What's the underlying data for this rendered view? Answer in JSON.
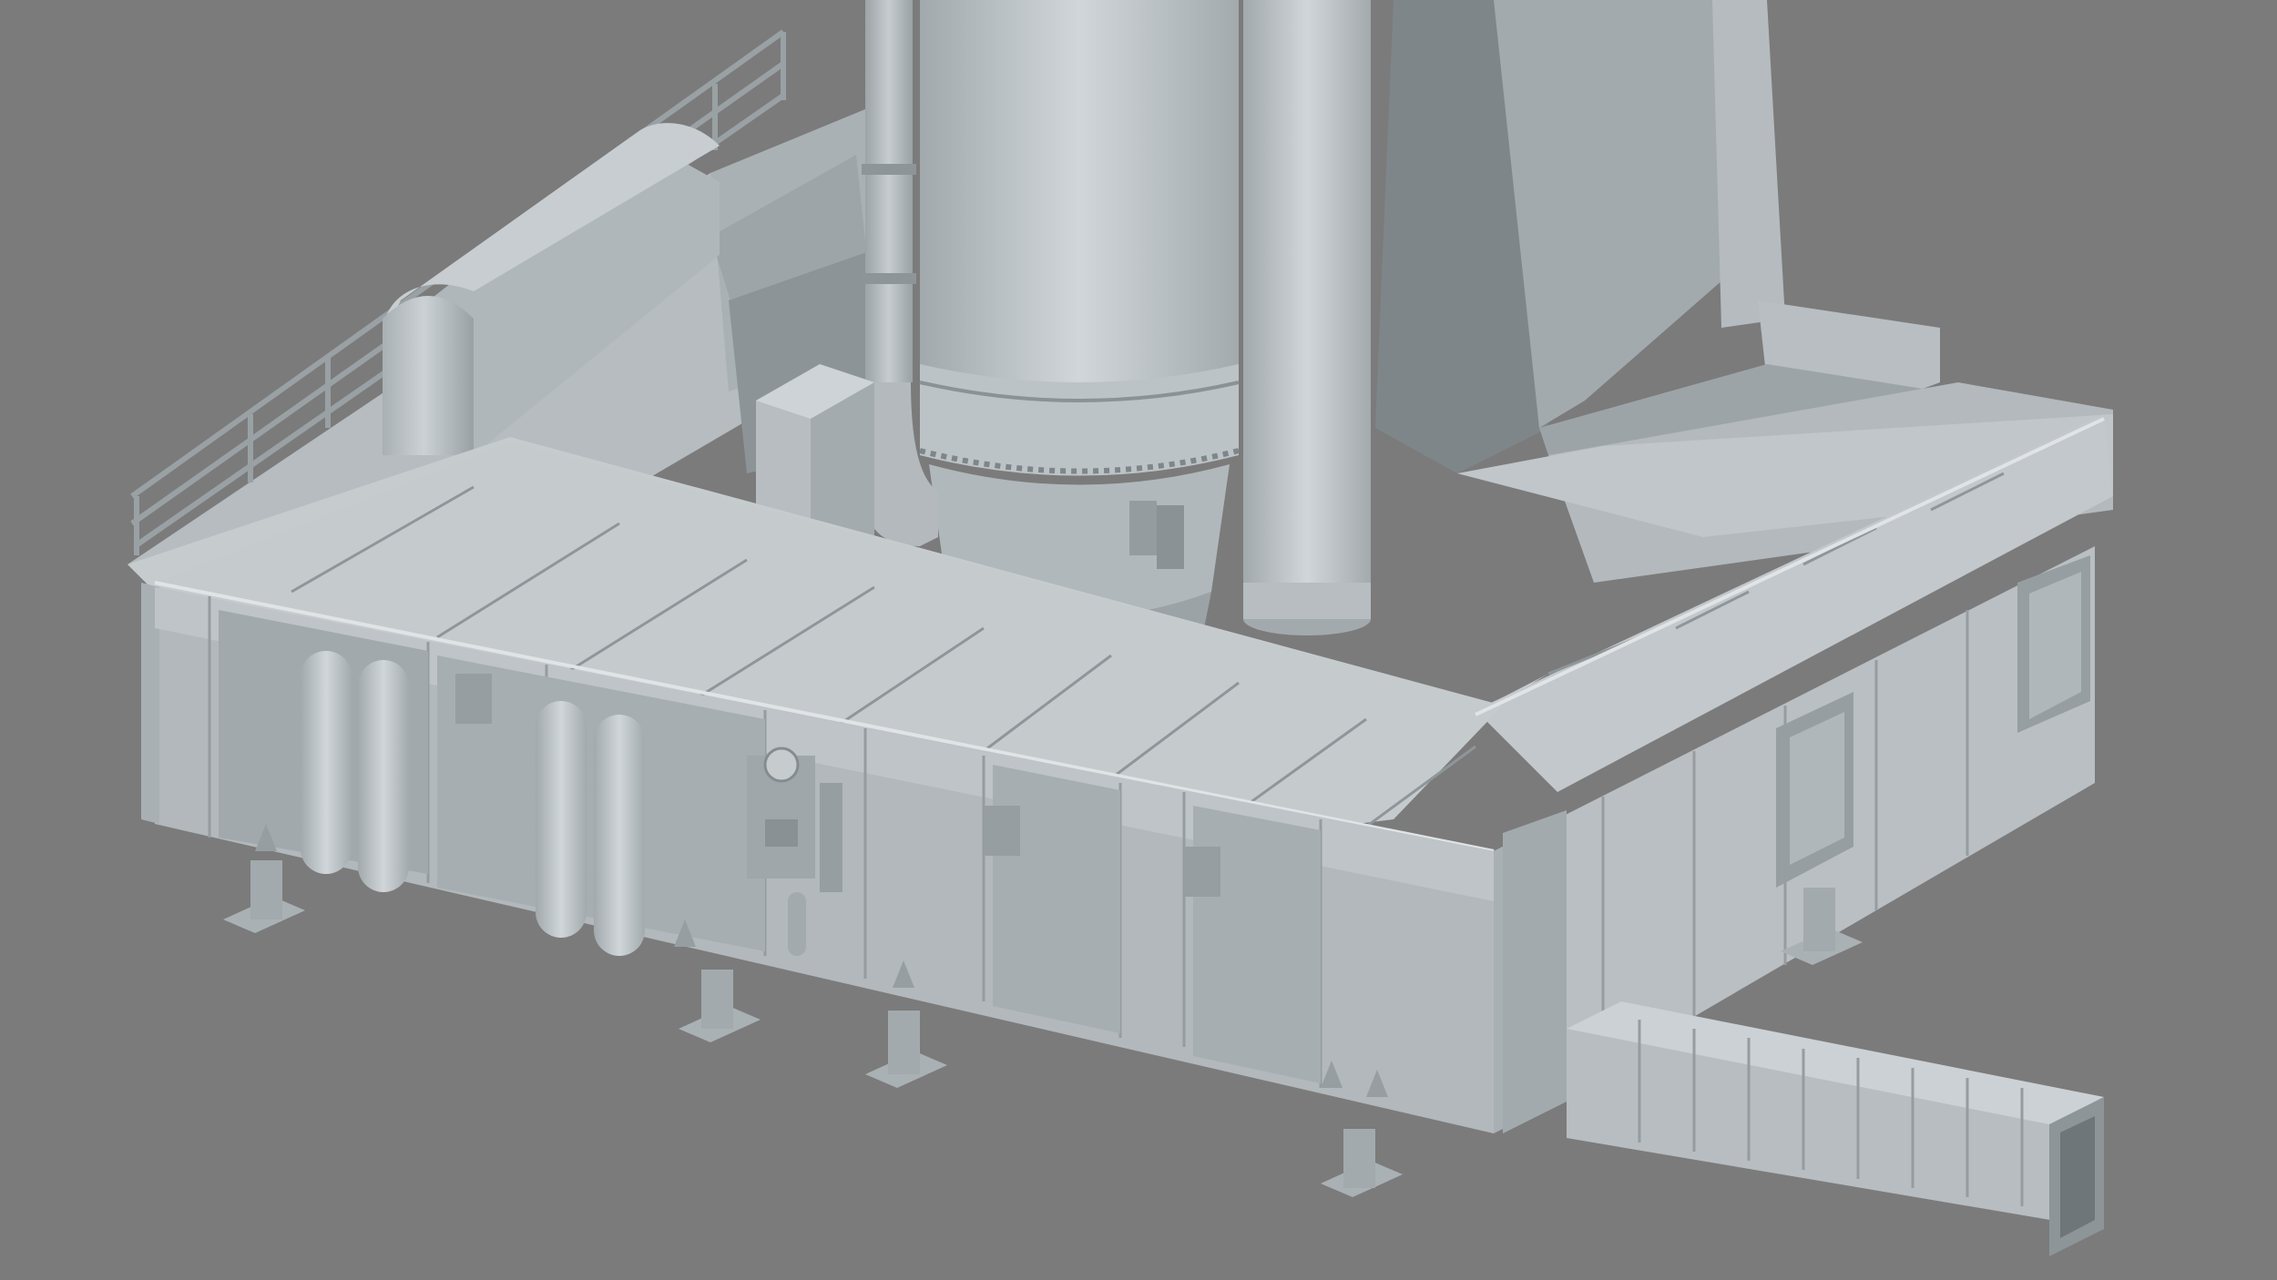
{
  "scene": {
    "kind": "untextured 3D render",
    "colors": {
      "background": "#7b7b7b",
      "model_light": "#c3c9cc",
      "model_mid": "#aab1b4",
      "model_dark": "#8e9598",
      "shadow": "#6d7477",
      "line": "#6a7073"
    }
  }
}
